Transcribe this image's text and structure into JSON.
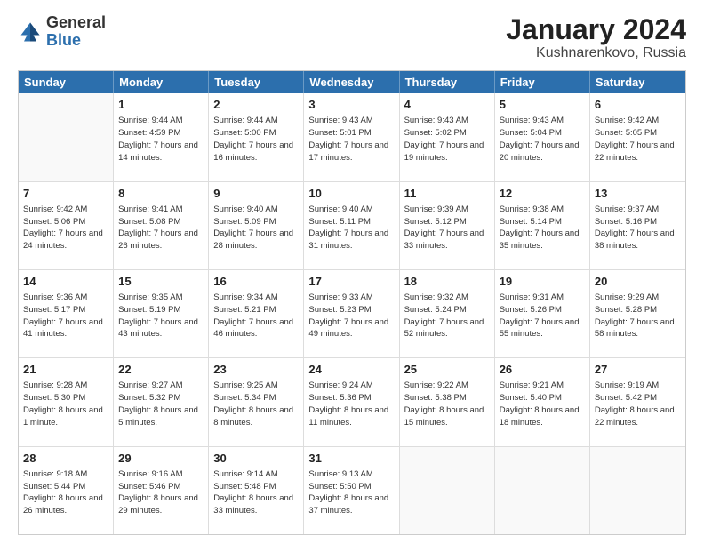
{
  "logo": {
    "general": "General",
    "blue": "Blue"
  },
  "title": "January 2024",
  "subtitle": "Kushnarenkovo, Russia",
  "days": [
    "Sunday",
    "Monday",
    "Tuesday",
    "Wednesday",
    "Thursday",
    "Friday",
    "Saturday"
  ],
  "weeks": [
    [
      {
        "day": "",
        "sunrise": "",
        "sunset": "",
        "daylight": ""
      },
      {
        "day": "1",
        "sunrise": "Sunrise: 9:44 AM",
        "sunset": "Sunset: 4:59 PM",
        "daylight": "Daylight: 7 hours and 14 minutes."
      },
      {
        "day": "2",
        "sunrise": "Sunrise: 9:44 AM",
        "sunset": "Sunset: 5:00 PM",
        "daylight": "Daylight: 7 hours and 16 minutes."
      },
      {
        "day": "3",
        "sunrise": "Sunrise: 9:43 AM",
        "sunset": "Sunset: 5:01 PM",
        "daylight": "Daylight: 7 hours and 17 minutes."
      },
      {
        "day": "4",
        "sunrise": "Sunrise: 9:43 AM",
        "sunset": "Sunset: 5:02 PM",
        "daylight": "Daylight: 7 hours and 19 minutes."
      },
      {
        "day": "5",
        "sunrise": "Sunrise: 9:43 AM",
        "sunset": "Sunset: 5:04 PM",
        "daylight": "Daylight: 7 hours and 20 minutes."
      },
      {
        "day": "6",
        "sunrise": "Sunrise: 9:42 AM",
        "sunset": "Sunset: 5:05 PM",
        "daylight": "Daylight: 7 hours and 22 minutes."
      }
    ],
    [
      {
        "day": "7",
        "sunrise": "Sunrise: 9:42 AM",
        "sunset": "Sunset: 5:06 PM",
        "daylight": "Daylight: 7 hours and 24 minutes."
      },
      {
        "day": "8",
        "sunrise": "Sunrise: 9:41 AM",
        "sunset": "Sunset: 5:08 PM",
        "daylight": "Daylight: 7 hours and 26 minutes."
      },
      {
        "day": "9",
        "sunrise": "Sunrise: 9:40 AM",
        "sunset": "Sunset: 5:09 PM",
        "daylight": "Daylight: 7 hours and 28 minutes."
      },
      {
        "day": "10",
        "sunrise": "Sunrise: 9:40 AM",
        "sunset": "Sunset: 5:11 PM",
        "daylight": "Daylight: 7 hours and 31 minutes."
      },
      {
        "day": "11",
        "sunrise": "Sunrise: 9:39 AM",
        "sunset": "Sunset: 5:12 PM",
        "daylight": "Daylight: 7 hours and 33 minutes."
      },
      {
        "day": "12",
        "sunrise": "Sunrise: 9:38 AM",
        "sunset": "Sunset: 5:14 PM",
        "daylight": "Daylight: 7 hours and 35 minutes."
      },
      {
        "day": "13",
        "sunrise": "Sunrise: 9:37 AM",
        "sunset": "Sunset: 5:16 PM",
        "daylight": "Daylight: 7 hours and 38 minutes."
      }
    ],
    [
      {
        "day": "14",
        "sunrise": "Sunrise: 9:36 AM",
        "sunset": "Sunset: 5:17 PM",
        "daylight": "Daylight: 7 hours and 41 minutes."
      },
      {
        "day": "15",
        "sunrise": "Sunrise: 9:35 AM",
        "sunset": "Sunset: 5:19 PM",
        "daylight": "Daylight: 7 hours and 43 minutes."
      },
      {
        "day": "16",
        "sunrise": "Sunrise: 9:34 AM",
        "sunset": "Sunset: 5:21 PM",
        "daylight": "Daylight: 7 hours and 46 minutes."
      },
      {
        "day": "17",
        "sunrise": "Sunrise: 9:33 AM",
        "sunset": "Sunset: 5:23 PM",
        "daylight": "Daylight: 7 hours and 49 minutes."
      },
      {
        "day": "18",
        "sunrise": "Sunrise: 9:32 AM",
        "sunset": "Sunset: 5:24 PM",
        "daylight": "Daylight: 7 hours and 52 minutes."
      },
      {
        "day": "19",
        "sunrise": "Sunrise: 9:31 AM",
        "sunset": "Sunset: 5:26 PM",
        "daylight": "Daylight: 7 hours and 55 minutes."
      },
      {
        "day": "20",
        "sunrise": "Sunrise: 9:29 AM",
        "sunset": "Sunset: 5:28 PM",
        "daylight": "Daylight: 7 hours and 58 minutes."
      }
    ],
    [
      {
        "day": "21",
        "sunrise": "Sunrise: 9:28 AM",
        "sunset": "Sunset: 5:30 PM",
        "daylight": "Daylight: 8 hours and 1 minute."
      },
      {
        "day": "22",
        "sunrise": "Sunrise: 9:27 AM",
        "sunset": "Sunset: 5:32 PM",
        "daylight": "Daylight: 8 hours and 5 minutes."
      },
      {
        "day": "23",
        "sunrise": "Sunrise: 9:25 AM",
        "sunset": "Sunset: 5:34 PM",
        "daylight": "Daylight: 8 hours and 8 minutes."
      },
      {
        "day": "24",
        "sunrise": "Sunrise: 9:24 AM",
        "sunset": "Sunset: 5:36 PM",
        "daylight": "Daylight: 8 hours and 11 minutes."
      },
      {
        "day": "25",
        "sunrise": "Sunrise: 9:22 AM",
        "sunset": "Sunset: 5:38 PM",
        "daylight": "Daylight: 8 hours and 15 minutes."
      },
      {
        "day": "26",
        "sunrise": "Sunrise: 9:21 AM",
        "sunset": "Sunset: 5:40 PM",
        "daylight": "Daylight: 8 hours and 18 minutes."
      },
      {
        "day": "27",
        "sunrise": "Sunrise: 9:19 AM",
        "sunset": "Sunset: 5:42 PM",
        "daylight": "Daylight: 8 hours and 22 minutes."
      }
    ],
    [
      {
        "day": "28",
        "sunrise": "Sunrise: 9:18 AM",
        "sunset": "Sunset: 5:44 PM",
        "daylight": "Daylight: 8 hours and 26 minutes."
      },
      {
        "day": "29",
        "sunrise": "Sunrise: 9:16 AM",
        "sunset": "Sunset: 5:46 PM",
        "daylight": "Daylight: 8 hours and 29 minutes."
      },
      {
        "day": "30",
        "sunrise": "Sunrise: 9:14 AM",
        "sunset": "Sunset: 5:48 PM",
        "daylight": "Daylight: 8 hours and 33 minutes."
      },
      {
        "day": "31",
        "sunrise": "Sunrise: 9:13 AM",
        "sunset": "Sunset: 5:50 PM",
        "daylight": "Daylight: 8 hours and 37 minutes."
      },
      {
        "day": "",
        "sunrise": "",
        "sunset": "",
        "daylight": ""
      },
      {
        "day": "",
        "sunrise": "",
        "sunset": "",
        "daylight": ""
      },
      {
        "day": "",
        "sunrise": "",
        "sunset": "",
        "daylight": ""
      }
    ]
  ]
}
